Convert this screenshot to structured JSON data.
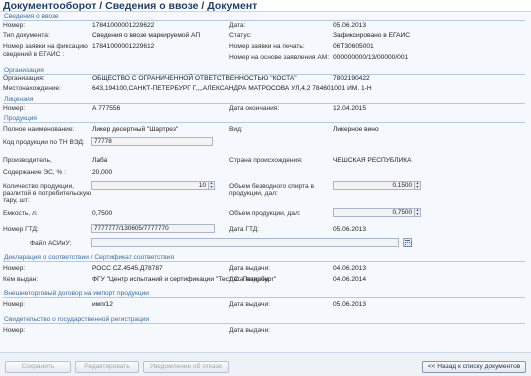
{
  "title": "Документооборот / Сведения о ввозе / Документ",
  "sections": {
    "import": "Сведения о ввозе",
    "organization": "Организация",
    "license": "Лицензия",
    "product": "Продукция",
    "declaration": "Декларация о соответствии / Сертификат соответствия",
    "contract": "Внешнеторговый договор на импорт продукции",
    "registration": "Свидетельство о государственной регистрации"
  },
  "import": {
    "number_label": "Номер:",
    "number": "17841000001229622",
    "date_label": "Дата:",
    "date": "05.06.2013",
    "doctype_label": "Тип документа:",
    "doctype": "Сведения о ввозе маркируемой АП",
    "status_label": "Статус:",
    "status": "Зафиксировано в ЕГАИС",
    "fix_label_1": "Номер заявки на фиксацию",
    "fix_label_2": "сведений в ЕГАИС :",
    "fix_number": "17841000001229612",
    "print_label": "Номер заявки на печать:",
    "print_number": "06Т30605001",
    "basis_label": "Номер на основе заявления АМ:",
    "basis_number": "000000000/13/00000/001"
  },
  "organization": {
    "org_label": "Организация:",
    "org_name": "ОБЩЕСТВО С ОГРАНИЧЕННОЙ ОТВЕТСТВЕННОСТЬЮ \"КОСТА\"",
    "org_code": "7802190422",
    "loc_label": "Местонахождение:",
    "loc_value": "643,194100,САНКТ-ПЕТЕРБУРГ Г,,,,АЛЕКСАНДРА МАТРОСОВА УЛ,4,2 784601001 ИМ. 1-Н"
  },
  "license": {
    "number_label": "Номер:",
    "number": "А 777556",
    "end_label": "Дата окончания:",
    "end_date": "12.04.2015"
  },
  "product": {
    "fullname_label": "Полное наименование:",
    "fullname": "Ликер десертный \"Шартрез\"",
    "kind_label": "Вид:",
    "kind": "Ликерное вино",
    "code_label": "Код продукции по ТН ВЭД:",
    "code": "77778",
    "maker_label": "Производитель,",
    "maker": "Лаба",
    "country_label": "Страна происхождения:",
    "country": "ЧЕШСКАЯ РЕСПУБЛИКА",
    "ethanol_label": "Содержание ЭС, % :",
    "ethanol": "20,000",
    "qty_label_1": "Количество продукции,",
    "qty_label_2": "разлитой в потребительскую",
    "qty_label_3": "тару, шт:",
    "qty": "10",
    "spirit_label_1": "Объем безводного спирта в",
    "spirit_label_2": "продукции, дал:",
    "spirit": "0,1500",
    "cap_label": "Емкость, л:",
    "capacity": "0,7500",
    "volume_label": "Объем продукции, дал:",
    "volume": "0,7500",
    "gtd_label": "Номер ГТД:",
    "gtd": "7777777/130605/7777770",
    "gtd_date_label": "Дата ГТД:",
    "gtd_date": "05.06.2013",
    "file_label": "Файл АСИиУ:",
    "file": ""
  },
  "declaration": {
    "number_label": "Номер:",
    "number": "РОСС CZ.4545.Д78787",
    "issue_label": "Дата выдачи:",
    "issue_date": "04.06.2013",
    "issuer_label": "Кем выдан:",
    "issuer": "ФГУ \"Центр испытаний и сертификации \"Тест С.-Петербург\"",
    "issue_label2": "Дата выдачи:",
    "issue_date2": "04.06.2014"
  },
  "contract": {
    "number_label": "Номер:",
    "number": "имп/12",
    "issue_label": "Дата выдачи:",
    "issue_date": "05.06.2013"
  },
  "registration": {
    "number_label": "Номер:",
    "number": "",
    "issue_label": "Дата выдачи:",
    "issue_date": ""
  },
  "buttons": {
    "save": "Сохранить",
    "edit": "Редактировать",
    "refusal": "Уведомление об отказе",
    "back": "<< Назад к списку документов"
  },
  "icons": {
    "spin_up": "▲",
    "spin_down": "▼",
    "calendar": "calendar-icon"
  }
}
